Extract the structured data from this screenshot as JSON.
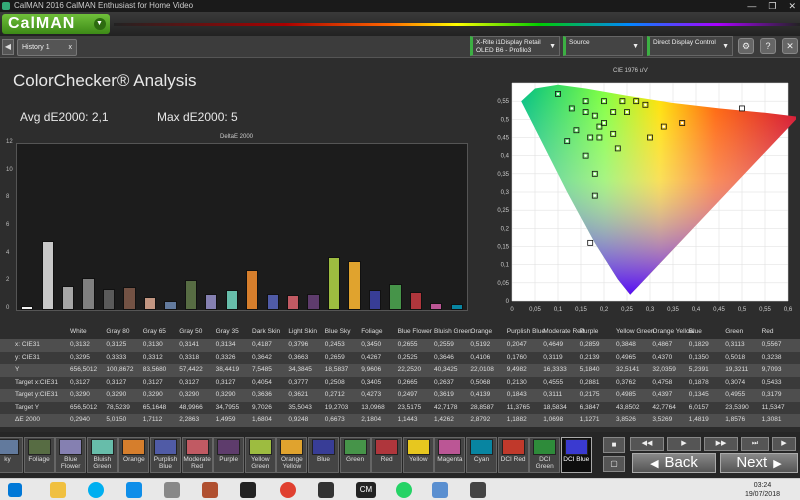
{
  "window": {
    "title": "CalMAN 2016 CalMAN Enthusiast for Home Video",
    "minimize": "—",
    "maximize": "❐",
    "close": "✕"
  },
  "app": {
    "logo": "CalMAN",
    "logo_menu": "▼"
  },
  "toolbar": {
    "nav_arrow": "◀",
    "tab": "History 1",
    "tab_close": "x",
    "meter_line1": "X-Rite i1Display Retail",
    "meter_line2": "OLED B6 - Profilo3",
    "source": "Source",
    "display": "Direct Display Control",
    "btn_icons": [
      "⚙",
      "?",
      "✕"
    ]
  },
  "analysis": {
    "title": "ColorChecker® Analysis",
    "avg": "Avg dE2000: 2,1",
    "max": "Max dE2000: 5"
  },
  "chart_data": [
    {
      "type": "bar",
      "title": "DeltaE 2000",
      "ylim": [
        0,
        12
      ],
      "yticks": [
        "12",
        "10",
        "8",
        "6",
        "4",
        "2",
        "0"
      ],
      "categories": [
        "White",
        "Gray 80",
        "Gray 65",
        "Gray 50",
        "Gray 35",
        "Dark Skin",
        "Light Skin",
        "Blue Sky",
        "Foliage",
        "Blue Flower",
        "Bluish Green",
        "Orange",
        "Purplish Blue",
        "Moderate Red",
        "Purple",
        "Yellow Green",
        "Orange Yellow",
        "Blue",
        "Green",
        "Red",
        "Magenta",
        "Cyan"
      ],
      "values": [
        0.294,
        5.015,
        1.7112,
        2.2863,
        1.4959,
        1.6804,
        0.9248,
        0.6673,
        2.1804,
        1.1443,
        1.4262,
        2.8792,
        1.1882,
        1.0698,
        1.1271,
        3.8526,
        3.5269,
        1.4819,
        1.8576,
        1.3081,
        0.5,
        0.4
      ],
      "colors": [
        "#f2f2f2",
        "#c8c8c8",
        "#a6a6a6",
        "#808080",
        "#5a5a5a",
        "#735244",
        "#c29682",
        "#627a9d",
        "#576c43",
        "#8580b1",
        "#67bdaa",
        "#d67e2c",
        "#505ba6",
        "#c15a63",
        "#5e3c6c",
        "#9dbc40",
        "#e0a32e",
        "#383d96",
        "#469449",
        "#af363c",
        "#bb5695",
        "#0885a1"
      ]
    },
    {
      "type": "scatter",
      "title": "CIE 1976 u'v'",
      "xlim": [
        0,
        0.6
      ],
      "ylim": [
        0,
        0.6
      ],
      "xticks": [
        "0",
        "0,05",
        "0,1",
        "0,15",
        "0,2",
        "0,25",
        "0,3",
        "0,35",
        "0,4",
        "0,45",
        "0,5",
        "0,55",
        "0,6"
      ],
      "yticks": [
        "0,55",
        "0,5",
        "0,45",
        "0,4",
        "0,35",
        "0,3",
        "0,25",
        "0,2",
        "0,15",
        "0,1",
        "0,05",
        "0"
      ],
      "points": [
        [
          0.1,
          0.57
        ],
        [
          0.16,
          0.55
        ],
        [
          0.2,
          0.55
        ],
        [
          0.24,
          0.55
        ],
        [
          0.27,
          0.55
        ],
        [
          0.29,
          0.54
        ],
        [
          0.13,
          0.53
        ],
        [
          0.16,
          0.52
        ],
        [
          0.22,
          0.52
        ],
        [
          0.25,
          0.52
        ],
        [
          0.18,
          0.51
        ],
        [
          0.2,
          0.49
        ],
        [
          0.33,
          0.48
        ],
        [
          0.37,
          0.49
        ],
        [
          0.5,
          0.53
        ],
        [
          0.14,
          0.47
        ],
        [
          0.19,
          0.48
        ],
        [
          0.12,
          0.44
        ],
        [
          0.17,
          0.45
        ],
        [
          0.19,
          0.45
        ],
        [
          0.22,
          0.46
        ],
        [
          0.3,
          0.45
        ],
        [
          0.23,
          0.42
        ],
        [
          0.16,
          0.4
        ],
        [
          0.18,
          0.35
        ],
        [
          0.18,
          0.29
        ],
        [
          0.17,
          0.16
        ]
      ]
    }
  ],
  "table": {
    "headers": [
      "White",
      "Gray 80",
      "Gray 65",
      "Gray 50",
      "Gray 35",
      "Dark Skin",
      "Light Skin",
      "Blue Sky",
      "Foliage",
      "Blue Flower",
      "Bluish Green",
      "Orange",
      "Purplish Blue",
      "Moderate Red",
      "Purple",
      "Yellow Green",
      "Orange Yellow",
      "Blue",
      "Green",
      "Red"
    ],
    "rows": [
      {
        "label": "x: CIE31",
        "values": [
          "0,3132",
          "0,3125",
          "0,3130",
          "0,3141",
          "0,3134",
          "0,4187",
          "0,3796",
          "0,2453",
          "0,3450",
          "0,2655",
          "0,2559",
          "0,5192",
          "0,2047",
          "0,4649",
          "0,2859",
          "0,3848",
          "0,4867",
          "0,1829",
          "0,3113",
          "0,5567"
        ]
      },
      {
        "label": "y: CIE31",
        "values": [
          "0,3295",
          "0,3333",
          "0,3312",
          "0,3318",
          "0,3326",
          "0,3642",
          "0,3663",
          "0,2659",
          "0,4267",
          "0,2525",
          "0,3646",
          "0,4106",
          "0,1760",
          "0,3119",
          "0,2139",
          "0,4965",
          "0,4370",
          "0,1350",
          "0,5018",
          "0,3238"
        ]
      },
      {
        "label": "Y",
        "values": [
          "656,5012",
          "100,8672",
          "83,5680",
          "57,4422",
          "38,4419",
          "7,5485",
          "34,3845",
          "18,5837",
          "9,9606",
          "22,2520",
          "40,3425",
          "22,0108",
          "9,4982",
          "16,3333",
          "5,1840",
          "32,5141",
          "32,0359",
          "5,2391",
          "19,3211",
          "9,7093"
        ]
      },
      {
        "label": "Target x:CIE31",
        "values": [
          "0,3127",
          "0,3127",
          "0,3127",
          "0,3127",
          "0,3127",
          "0,4054",
          "0,3777",
          "0,2508",
          "0,3405",
          "0,2665",
          "0,2637",
          "0,5068",
          "0,2130",
          "0,4555",
          "0,2881",
          "0,3762",
          "0,4758",
          "0,1878",
          "0,3074",
          "0,5433"
        ]
      },
      {
        "label": "Target y:CIE31",
        "values": [
          "0,3290",
          "0,3290",
          "0,3290",
          "0,3290",
          "0,3290",
          "0,3636",
          "0,3621",
          "0,2712",
          "0,4273",
          "0,2497",
          "0,3619",
          "0,4139",
          "0,1843",
          "0,3111",
          "0,2175",
          "0,4985",
          "0,4397",
          "0,1345",
          "0,4955",
          "0,3179"
        ]
      },
      {
        "label": "Target Y",
        "values": [
          "656,5012",
          "78,5239",
          "65,1648",
          "48,9966",
          "34,7955",
          "9,7026",
          "35,5043",
          "19,2703",
          "13,0968",
          "23,5175",
          "42,7178",
          "28,8587",
          "11,3765",
          "18,5834",
          "6,3847",
          "43,8502",
          "42,7764",
          "6,0157",
          "23,5390",
          "11,5347"
        ]
      },
      {
        "label": "ΔE 2000",
        "values": [
          "0,2940",
          "5,0150",
          "1,7112",
          "2,2863",
          "1,4959",
          "1,6804",
          "0,9248",
          "0,6673",
          "2,1804",
          "1,1443",
          "1,4262",
          "2,8792",
          "1,1882",
          "1,0698",
          "1,1271",
          "3,8526",
          "3,5269",
          "1,4819",
          "1,8576",
          "1,3081"
        ]
      }
    ]
  },
  "swatches": [
    {
      "l1": "ky",
      "l2": "",
      "color": "#627a9d"
    },
    {
      "l1": "Foliage",
      "l2": "",
      "color": "#576c43"
    },
    {
      "l1": "Blue",
      "l2": "Flower",
      "color": "#8580b1"
    },
    {
      "l1": "Bluish",
      "l2": "Green",
      "color": "#67bdaa"
    },
    {
      "l1": "Orange",
      "l2": "",
      "color": "#d67e2c"
    },
    {
      "l1": "Purplish",
      "l2": "Blue",
      "color": "#505ba6"
    },
    {
      "l1": "Moderate",
      "l2": "Red",
      "color": "#c15a63"
    },
    {
      "l1": "Purple",
      "l2": "",
      "color": "#5e3c6c"
    },
    {
      "l1": "Yellow",
      "l2": "Green",
      "color": "#9dbc40"
    },
    {
      "l1": "Orange",
      "l2": "Yellow",
      "color": "#e0a32e"
    },
    {
      "l1": "Blue",
      "l2": "",
      "color": "#383d96"
    },
    {
      "l1": "Green",
      "l2": "",
      "color": "#469449"
    },
    {
      "l1": "Red",
      "l2": "",
      "color": "#af363c"
    },
    {
      "l1": "Yellow",
      "l2": "",
      "color": "#e7c71f"
    },
    {
      "l1": "Magenta",
      "l2": "",
      "color": "#bb5695"
    },
    {
      "l1": "Cyan",
      "l2": "",
      "color": "#0885a1"
    },
    {
      "l1": "DCI Red",
      "l2": "",
      "color": "#c0392b"
    },
    {
      "l1": "DCI",
      "l2": "Green",
      "color": "#2e8b3a"
    },
    {
      "l1": "DCI Blue",
      "l2": "",
      "color": "#3a3ad0"
    }
  ],
  "controls": {
    "back": "Back",
    "next": "Next",
    "back_arrow": "◀",
    "next_arrow": "▶",
    "stop": "■",
    "sq1": "▢",
    "play_back": "◀◀",
    "play": "▶",
    "play_next": "▶▶",
    "skip": "⏭",
    "play_small": "▶"
  },
  "taskbar": {
    "time": "03:24",
    "date": "19/07/2018",
    "cm": "CM"
  }
}
